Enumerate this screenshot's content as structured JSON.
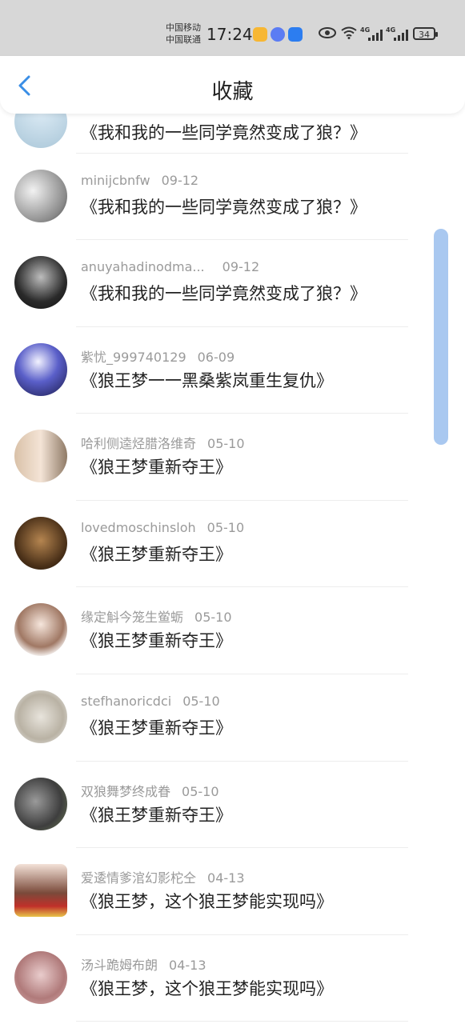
{
  "status_bar": {
    "carrier_1": "中国移动",
    "carrier_2": "中国联通",
    "time": "17:24",
    "network_1": "4G",
    "network_2": "4G",
    "battery": "34"
  },
  "header": {
    "title": "收藏"
  },
  "items": [
    {
      "user": "",
      "date": "",
      "text": "《我和我的一些同学竟然变成了狼？》"
    },
    {
      "user": "minijcbnfw",
      "date": "09-12",
      "text": "《我和我的一些同学竟然变成了狼？》"
    },
    {
      "user": "anuyahadinodma...",
      "date": "09-12",
      "text": "《我和我的一些同学竟然变成了狼？》"
    },
    {
      "user": "紫忧_999740129",
      "date": "06-09",
      "text": "《狼王梦一一黑桑紫岚重生复仇》"
    },
    {
      "user": "哈利侧逵烃腊洛维奇",
      "date": "05-10",
      "text": "《狼王梦重新夺王》"
    },
    {
      "user": "lovedmoschinsloh",
      "date": "05-10",
      "text": "《狼王梦重新夺王》"
    },
    {
      "user": "缘定斛今笼生鲎蛎",
      "date": "05-10",
      "text": "《狼王梦重新夺王》"
    },
    {
      "user": "stefhanoricdci",
      "date": "05-10",
      "text": "《狼王梦重新夺王》"
    },
    {
      "user": "双狼舞梦终成眷",
      "date": "05-10",
      "text": "《狼王梦重新夺王》"
    },
    {
      "user": "爱逶情爹涫幻影柁仝",
      "date": "04-13",
      "text": "《狼王梦，这个狼王梦能实现吗》"
    },
    {
      "user": "汤斗跪姆布朗",
      "date": "04-13",
      "text": "《狼王梦，这个狼王梦能实现吗》"
    }
  ],
  "colors": {
    "accent": "#3a8ee6",
    "scroll_thumb": "#a9c8f0",
    "meta_text": "#9a9a9a"
  }
}
